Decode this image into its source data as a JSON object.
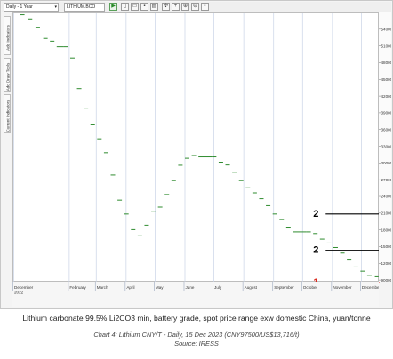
{
  "toolbar": {
    "period_select": "Daily - 1 Year",
    "symbol_input": "LITHIUM.BCO",
    "buttons": [
      "play",
      "page",
      "open",
      "save",
      "print",
      "settings",
      "crosshair",
      "zoom-in",
      "zoom-out",
      "more"
    ]
  },
  "side_tabs": [
    "Add Indicators",
    "Add Draw Tools",
    "Current Indicators"
  ],
  "chart_data": {
    "type": "line",
    "title": "Lithium carbonate 99.5% Li2CO3 min, battery grade, spot price range exw domestic China, yuan/tonne",
    "subtitle": "Chart 4: Lithium CNY/T - Daily, 15 Dec 2023 (CNY97500/US$13,716/t)",
    "source": "Source: IRESS",
    "series": [
      {
        "values_note": "",
        "x": [
          "2022-12-12",
          "2022-12-20",
          "2022-12-28",
          "2023-01-05",
          "2023-01-12",
          "2023-01-19",
          "2023-01-26",
          "2023-02-02",
          "2023-02-09",
          "2023-02-16",
          "2023-02-23",
          "2023-03-02",
          "2023-03-09",
          "2023-03-16",
          "2023-03-23",
          "2023-03-30",
          "2023-04-06",
          "2023-04-13",
          "2023-04-20",
          "2023-04-27",
          "2023-05-04",
          "2023-05-11",
          "2023-05-18",
          "2023-05-25",
          "2023-06-01",
          "2023-06-08",
          "2023-06-15",
          "2023-06-22",
          "2023-06-29",
          "2023-07-06",
          "2023-07-13",
          "2023-07-20",
          "2023-07-27",
          "2023-08-03",
          "2023-08-10",
          "2023-08-17",
          "2023-08-24",
          "2023-08-31",
          "2023-09-07",
          "2023-09-14",
          "2023-09-21",
          "2023-09-28",
          "2023-10-05",
          "2023-10-12",
          "2023-10-19",
          "2023-10-26",
          "2023-11-02",
          "2023-11-09",
          "2023-11-16",
          "2023-11-23",
          "2023-11-30",
          "2023-12-07",
          "2023-12-15"
        ],
        "y": [
          567500,
          560000,
          545000,
          525000,
          520000,
          510000,
          510000,
          490000,
          435000,
          400000,
          370000,
          345000,
          320000,
          280000,
          235000,
          210000,
          182000,
          172000,
          190000,
          215000,
          222500,
          245000,
          270000,
          297500,
          310000,
          315000,
          312500,
          312500,
          312500,
          303000,
          298000,
          285000,
          270000,
          258000,
          248000,
          237500,
          225000,
          210000,
          200000,
          185000,
          178000,
          178000,
          178000,
          175000,
          165000,
          158000,
          150000,
          140000,
          127500,
          115000,
          107500,
          100000,
          97500
        ]
      }
    ],
    "y_tick_labels": [
      "540000",
      "510000",
      "480000",
      "450000",
      "420000",
      "390000",
      "360000",
      "330000",
      "300000",
      "270000",
      "240000",
      "210000",
      "180000",
      "150000",
      "120000",
      "90000"
    ],
    "ylim": [
      87000,
      570000
    ],
    "xlim": [
      "2022-12-05",
      "2023-12-20"
    ],
    "x_tick_labels": [
      "December\n2022",
      "February",
      "March",
      "April",
      "May",
      "June",
      "July",
      "August",
      "September",
      "October",
      "November",
      "December"
    ],
    "x_tick_dates": [
      "2022-12-01",
      "2023-02-01",
      "2023-03-01",
      "2023-04-01",
      "2023-05-01",
      "2023-06-01",
      "2023-07-01",
      "2023-08-01",
      "2023-09-01",
      "2023-10-01",
      "2023-11-01",
      "2023-12-01"
    ],
    "grid": "vertical lines at month starts",
    "line_color": "#2e8b2e",
    "annotations": [
      {
        "text": "2",
        "level": 210000,
        "date_start": "2023-10-25",
        "date_end": "2023-12-20",
        "color": "#000000"
      },
      {
        "text": "2",
        "level": 145000,
        "date_start": "2023-10-25",
        "date_end": "2023-12-20",
        "color": "#000000"
      },
      {
        "text": "1",
        "level": 87000,
        "date_start": "2023-10-25",
        "date_end": "2023-12-20",
        "color": "#d9281c"
      }
    ]
  },
  "captions": {
    "line1": "Lithium carbonate 99.5% Li2CO3 min, battery grade, spot price range exw domestic China, yuan/tonne",
    "line2": "Chart 4: Lithium CNY/T - Daily, 15 Dec 2023 (CNY97500/US$13,716/t)",
    "line3": "Source: IRESS"
  }
}
